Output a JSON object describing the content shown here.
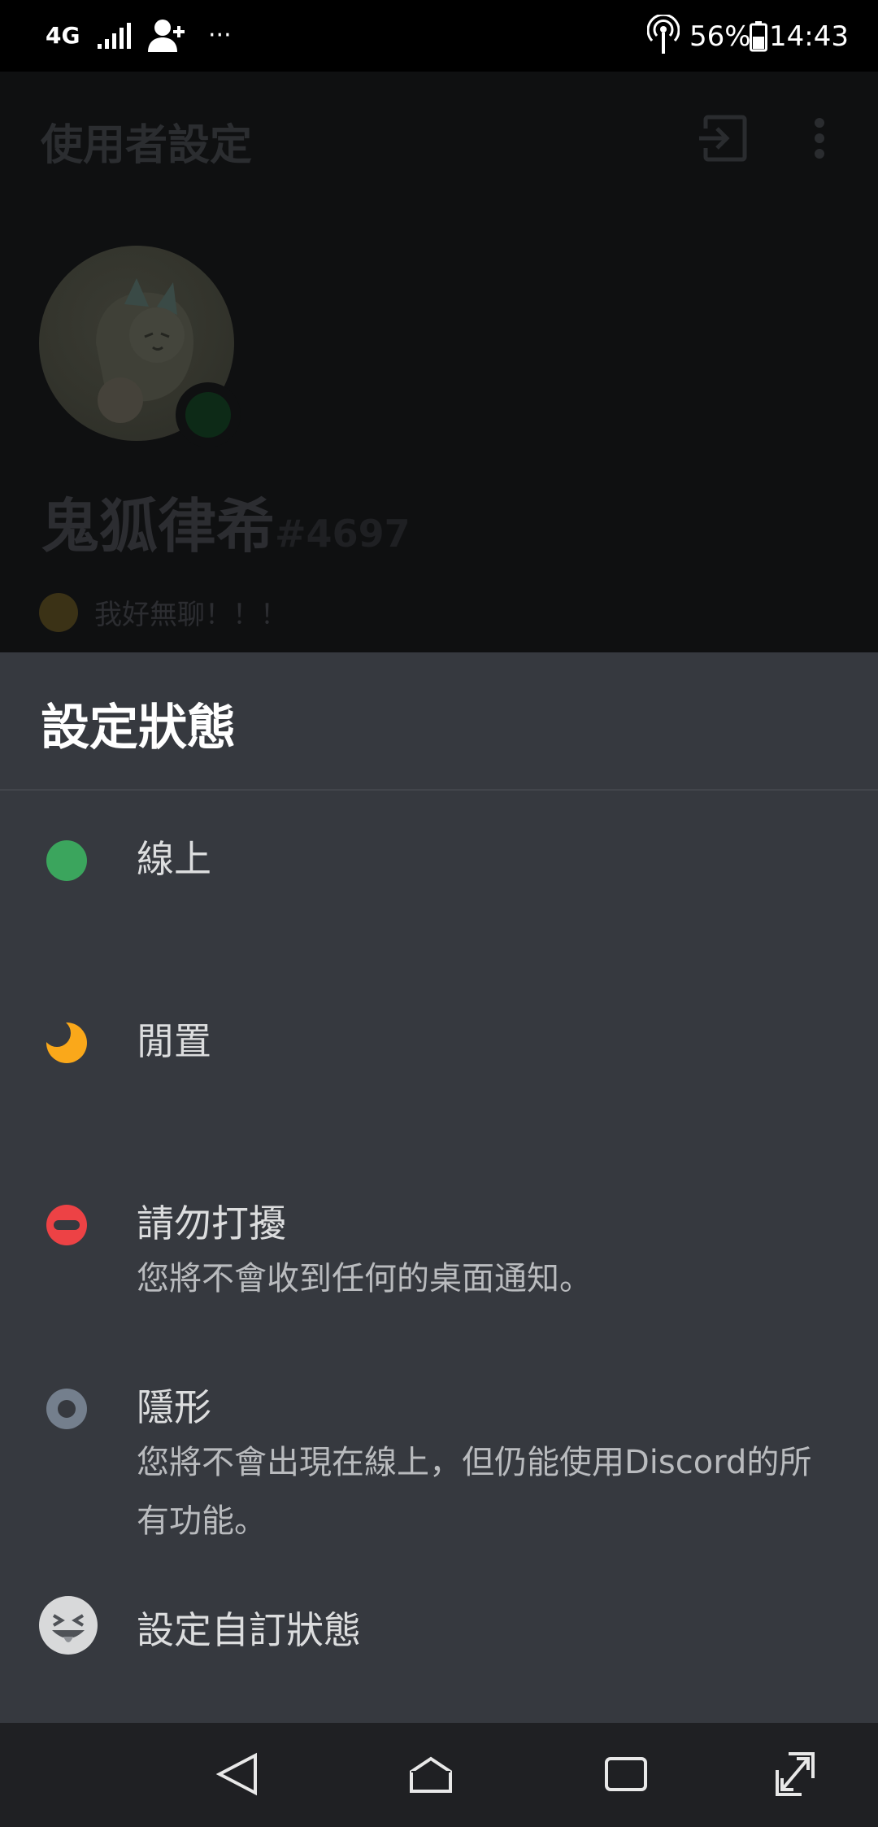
{
  "status_bar": {
    "network": "4G",
    "more": "···",
    "battery": "56%",
    "time": "14:43",
    "icons": [
      "network-4g-icon",
      "signal-icon",
      "add-person-icon",
      "hotspot-icon",
      "battery-icon"
    ]
  },
  "background_app": {
    "title": "使用者設定",
    "username": "鬼狐律希",
    "discriminator": "#4697",
    "custom_status": "我好無聊！！！",
    "icons": [
      "logout-icon",
      "overflow-menu-icon"
    ]
  },
  "sheet": {
    "title": "設定狀態",
    "options": [
      {
        "label": "線上",
        "icon": "online-dot-icon",
        "color": "#3ba55d"
      },
      {
        "label": "閒置",
        "icon": "idle-moon-icon",
        "color": "#faa81a"
      },
      {
        "label": "請勿打擾",
        "description": "您將不會收到任何的桌面通知。",
        "icon": "dnd-icon",
        "color": "#ed4245"
      },
      {
        "label": "隱形",
        "description": "您將不會出現在線上，但仍能使用Discord的所有功能。",
        "icon": "invisible-icon",
        "color": "#747f8d"
      },
      {
        "label": "設定自訂狀態",
        "icon": "custom-status-emoji-icon"
      }
    ]
  },
  "nav_bar": {
    "icons": [
      "back-icon",
      "home-icon",
      "recent-apps-icon",
      "expand-icon"
    ]
  },
  "colors": {
    "sheet_bg": "#36393f",
    "text_primary": "#dcddde",
    "text_secondary": "#b9bbbe",
    "navbar_bg": "#1f2023"
  }
}
